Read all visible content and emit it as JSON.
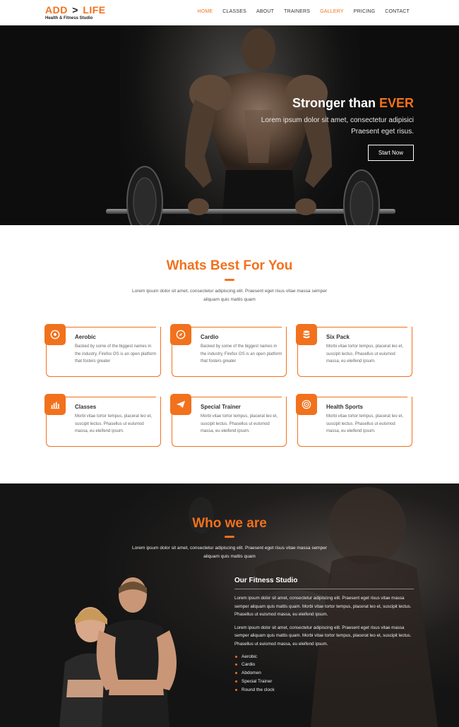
{
  "header": {
    "logo_left": "ADD",
    "logo_arrow": ">",
    "logo_right": "LIFE",
    "logo_tagline": "Health & Fitness Studio",
    "nav": [
      {
        "label": "HOME"
      },
      {
        "label": "CLASSES"
      },
      {
        "label": "ABOUT"
      },
      {
        "label": "TRAINERS"
      },
      {
        "label": "GALLERY"
      },
      {
        "label": "PRICING"
      },
      {
        "label": "CONTACT"
      }
    ]
  },
  "hero": {
    "title_main": "Stronger than ",
    "title_highlight": "EVER",
    "subtitle": "Lorem ipsum dolor sit amet, consectetur adipisici Praesent eget risus.",
    "cta_label": "Start Now"
  },
  "best": {
    "title": "Whats Best For You",
    "description": "Lorem ipsum dolor sit amet, consectetur adipiscing elit. Praesent eget risus vitae massa semper aliquam quis mattis quam",
    "features": [
      {
        "title": "Aerobic",
        "text": "Backed by some of the biggest names in the industry, Firefox OS is an open platform that fosters greater",
        "icon": "soccer-ball-icon"
      },
      {
        "title": "Cardio",
        "text": "Backed by some of the biggest names in the industry, Firefox OS is an open platform that fosters greater",
        "icon": "compass-icon"
      },
      {
        "title": "Six Pack",
        "text": "Morbi vitae tortor tempus, placerat leo et, suscipit lectus. Phasellus ut euismod massa, eu eleifend ipsum.",
        "icon": "database-icon"
      },
      {
        "title": "Classes",
        "text": "Morbi vitae tortor tempus, placerat leo et, suscipit lectus. Phasellus ut euismod massa, eu eleifend ipsum.",
        "icon": "bar-chart-icon"
      },
      {
        "title": "Special Trainer",
        "text": "Morbi vitae tortor tempus, placerat leo et, suscipit lectus. Phasellus ut euismod massa, eu eleifend ipsum.",
        "icon": "paper-plane-icon"
      },
      {
        "title": "Health Sports",
        "text": "Morbi vitae tortor tempus, placerat leo et, suscipit lectus. Phasellus ut euismod massa, eu eleifend ipsum.",
        "icon": "target-icon"
      }
    ]
  },
  "who": {
    "title": "Who we are",
    "description": "Lorem ipsum dolor sit amet, consectetur adipiscing elit. Praesent eget risus vitae massa semper aliquam quis mattis quam",
    "studio_title": "Our Fitness Studio",
    "paragraph_1": "Lorem ipsum dolor sit amet, consectetur adipiscing elit. Praesent eget risus vitae massa semper aliquam quis mattis quam. Morbi vitae tortor tempus, placerat leo et, suscipit lectus. Phasellus ut euismod massa, eu eleifend ipsum.",
    "paragraph_2": "Lorem ipsum dolor sit amet, consectetur adipiscing elit. Praesent eget risus vitae massa semper aliquam quis mattis quam. Morbi vitae tortor tempus, placerat leo et, suscipit lectus. Phasellus ut euismod massa, eu eleifend ipsum.",
    "list": [
      "Aerobic",
      "Cardio",
      "Abdomen",
      "Special Trainer",
      "Round the clock"
    ]
  },
  "colors": {
    "accent": "#f2711c",
    "dark": "#151515",
    "text": "#555555"
  }
}
